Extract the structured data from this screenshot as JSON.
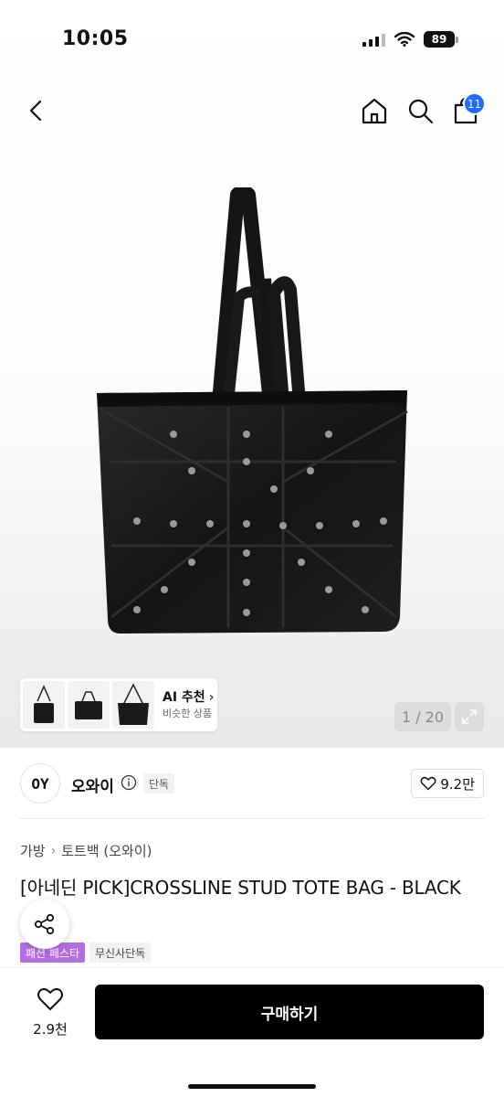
{
  "status_bar": {
    "time": "10:05",
    "battery": "89"
  },
  "nav": {
    "cart_count": "11"
  },
  "gallery": {
    "ai_title": "AI 추천",
    "ai_subtitle": "비슷한 상품",
    "counter": "1 / 20"
  },
  "brand": {
    "logo_text": "OY",
    "name": "오와이",
    "exclusive_badge": "단독",
    "like_count": "9.2만"
  },
  "breadcrumb": [
    "가방",
    "토트백 (오와이)"
  ],
  "product": {
    "title": "[아네딘 PICK]CROSSLINE STUD TOTE BAG - BLACK"
  },
  "tags": {
    "festival": "패션 페스타",
    "exclusive": "무신사단독"
  },
  "bottom_bar": {
    "wish_count": "2.9천",
    "buy_label": "구매하기"
  }
}
